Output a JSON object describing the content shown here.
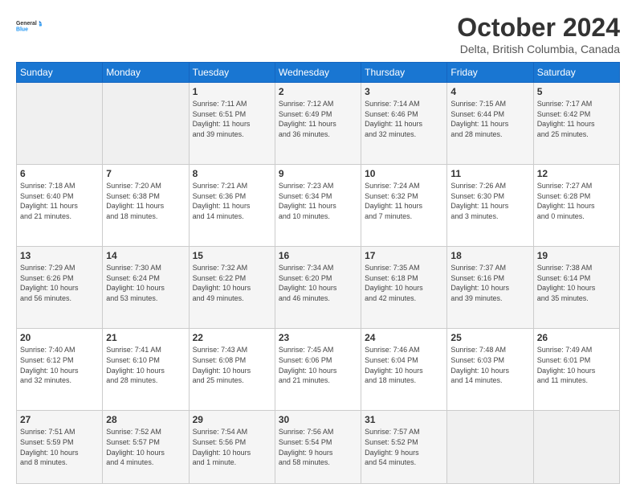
{
  "logo": {
    "line1": "General",
    "line2": "Blue"
  },
  "title": "October 2024",
  "location": "Delta, British Columbia, Canada",
  "days_header": [
    "Sunday",
    "Monday",
    "Tuesday",
    "Wednesday",
    "Thursday",
    "Friday",
    "Saturday"
  ],
  "weeks": [
    [
      {
        "day": "",
        "info": ""
      },
      {
        "day": "",
        "info": ""
      },
      {
        "day": "1",
        "info": "Sunrise: 7:11 AM\nSunset: 6:51 PM\nDaylight: 11 hours\nand 39 minutes."
      },
      {
        "day": "2",
        "info": "Sunrise: 7:12 AM\nSunset: 6:49 PM\nDaylight: 11 hours\nand 36 minutes."
      },
      {
        "day": "3",
        "info": "Sunrise: 7:14 AM\nSunset: 6:46 PM\nDaylight: 11 hours\nand 32 minutes."
      },
      {
        "day": "4",
        "info": "Sunrise: 7:15 AM\nSunset: 6:44 PM\nDaylight: 11 hours\nand 28 minutes."
      },
      {
        "day": "5",
        "info": "Sunrise: 7:17 AM\nSunset: 6:42 PM\nDaylight: 11 hours\nand 25 minutes."
      }
    ],
    [
      {
        "day": "6",
        "info": "Sunrise: 7:18 AM\nSunset: 6:40 PM\nDaylight: 11 hours\nand 21 minutes."
      },
      {
        "day": "7",
        "info": "Sunrise: 7:20 AM\nSunset: 6:38 PM\nDaylight: 11 hours\nand 18 minutes."
      },
      {
        "day": "8",
        "info": "Sunrise: 7:21 AM\nSunset: 6:36 PM\nDaylight: 11 hours\nand 14 minutes."
      },
      {
        "day": "9",
        "info": "Sunrise: 7:23 AM\nSunset: 6:34 PM\nDaylight: 11 hours\nand 10 minutes."
      },
      {
        "day": "10",
        "info": "Sunrise: 7:24 AM\nSunset: 6:32 PM\nDaylight: 11 hours\nand 7 minutes."
      },
      {
        "day": "11",
        "info": "Sunrise: 7:26 AM\nSunset: 6:30 PM\nDaylight: 11 hours\nand 3 minutes."
      },
      {
        "day": "12",
        "info": "Sunrise: 7:27 AM\nSunset: 6:28 PM\nDaylight: 11 hours\nand 0 minutes."
      }
    ],
    [
      {
        "day": "13",
        "info": "Sunrise: 7:29 AM\nSunset: 6:26 PM\nDaylight: 10 hours\nand 56 minutes."
      },
      {
        "day": "14",
        "info": "Sunrise: 7:30 AM\nSunset: 6:24 PM\nDaylight: 10 hours\nand 53 minutes."
      },
      {
        "day": "15",
        "info": "Sunrise: 7:32 AM\nSunset: 6:22 PM\nDaylight: 10 hours\nand 49 minutes."
      },
      {
        "day": "16",
        "info": "Sunrise: 7:34 AM\nSunset: 6:20 PM\nDaylight: 10 hours\nand 46 minutes."
      },
      {
        "day": "17",
        "info": "Sunrise: 7:35 AM\nSunset: 6:18 PM\nDaylight: 10 hours\nand 42 minutes."
      },
      {
        "day": "18",
        "info": "Sunrise: 7:37 AM\nSunset: 6:16 PM\nDaylight: 10 hours\nand 39 minutes."
      },
      {
        "day": "19",
        "info": "Sunrise: 7:38 AM\nSunset: 6:14 PM\nDaylight: 10 hours\nand 35 minutes."
      }
    ],
    [
      {
        "day": "20",
        "info": "Sunrise: 7:40 AM\nSunset: 6:12 PM\nDaylight: 10 hours\nand 32 minutes."
      },
      {
        "day": "21",
        "info": "Sunrise: 7:41 AM\nSunset: 6:10 PM\nDaylight: 10 hours\nand 28 minutes."
      },
      {
        "day": "22",
        "info": "Sunrise: 7:43 AM\nSunset: 6:08 PM\nDaylight: 10 hours\nand 25 minutes."
      },
      {
        "day": "23",
        "info": "Sunrise: 7:45 AM\nSunset: 6:06 PM\nDaylight: 10 hours\nand 21 minutes."
      },
      {
        "day": "24",
        "info": "Sunrise: 7:46 AM\nSunset: 6:04 PM\nDaylight: 10 hours\nand 18 minutes."
      },
      {
        "day": "25",
        "info": "Sunrise: 7:48 AM\nSunset: 6:03 PM\nDaylight: 10 hours\nand 14 minutes."
      },
      {
        "day": "26",
        "info": "Sunrise: 7:49 AM\nSunset: 6:01 PM\nDaylight: 10 hours\nand 11 minutes."
      }
    ],
    [
      {
        "day": "27",
        "info": "Sunrise: 7:51 AM\nSunset: 5:59 PM\nDaylight: 10 hours\nand 8 minutes."
      },
      {
        "day": "28",
        "info": "Sunrise: 7:52 AM\nSunset: 5:57 PM\nDaylight: 10 hours\nand 4 minutes."
      },
      {
        "day": "29",
        "info": "Sunrise: 7:54 AM\nSunset: 5:56 PM\nDaylight: 10 hours\nand 1 minute."
      },
      {
        "day": "30",
        "info": "Sunrise: 7:56 AM\nSunset: 5:54 PM\nDaylight: 9 hours\nand 58 minutes."
      },
      {
        "day": "31",
        "info": "Sunrise: 7:57 AM\nSunset: 5:52 PM\nDaylight: 9 hours\nand 54 minutes."
      },
      {
        "day": "",
        "info": ""
      },
      {
        "day": "",
        "info": ""
      }
    ]
  ]
}
